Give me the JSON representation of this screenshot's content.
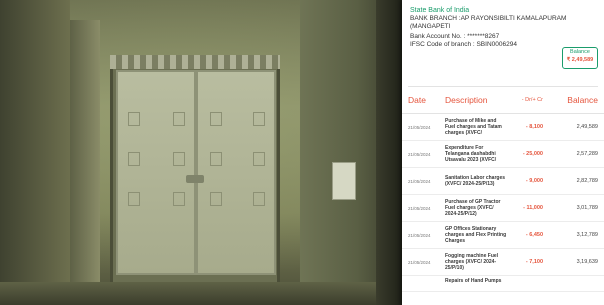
{
  "account": {
    "bank_name": "State Bank of India",
    "branch": "Bank Branch :AP RAYONSIBILTI KAMALAPURAM (MANGAPETI",
    "account_no": "Bank Account No. : *******8267",
    "ifsc": "IFSC Code of branch : SBIN0006294",
    "balance_label": "Balance",
    "balance_value": "₹ 2,49,589"
  },
  "table": {
    "headers": {
      "date": "Date",
      "description": "Description",
      "drcr": "- Dr/+ Cr",
      "balance": "Balance"
    },
    "rows": [
      {
        "date": "21/05/2024",
        "description": "Purchase of Mike and Fuel charges and Tatam charges (XVFC/",
        "amount": "- 8,100",
        "balance": "2,49,589"
      },
      {
        "date": "21/05/2024",
        "description": "Expenditure For Telangana dashabdhi Utsavalu 2023 (XVFC/",
        "amount": "- 25,000",
        "balance": "2,57,289"
      },
      {
        "date": "21/05/2024",
        "description": "Sanitation Labor charges (XVFC/ 2024-25/P/13)",
        "amount": "- 9,000",
        "balance": "2,82,789"
      },
      {
        "date": "21/05/2024",
        "description": "Purchase of GP Tractor Fuel charges (XVFC/ 2024-25/P/12)",
        "amount": "- 11,000",
        "balance": "3,01,789"
      },
      {
        "date": "21/05/2024",
        "description": "GP Offices Stationary charges and Flex Printing Charges",
        "amount": "- 6,450",
        "balance": "3,12,789"
      },
      {
        "date": "21/05/2024",
        "description": "Fogging machine Fuel charges (XVFC/ 2024-25/P/10)",
        "amount": "- 7,100",
        "balance": "3,19,639"
      },
      {
        "date": "",
        "description": "Repairs of Hand Pumps",
        "amount": "",
        "balance": ""
      }
    ]
  }
}
